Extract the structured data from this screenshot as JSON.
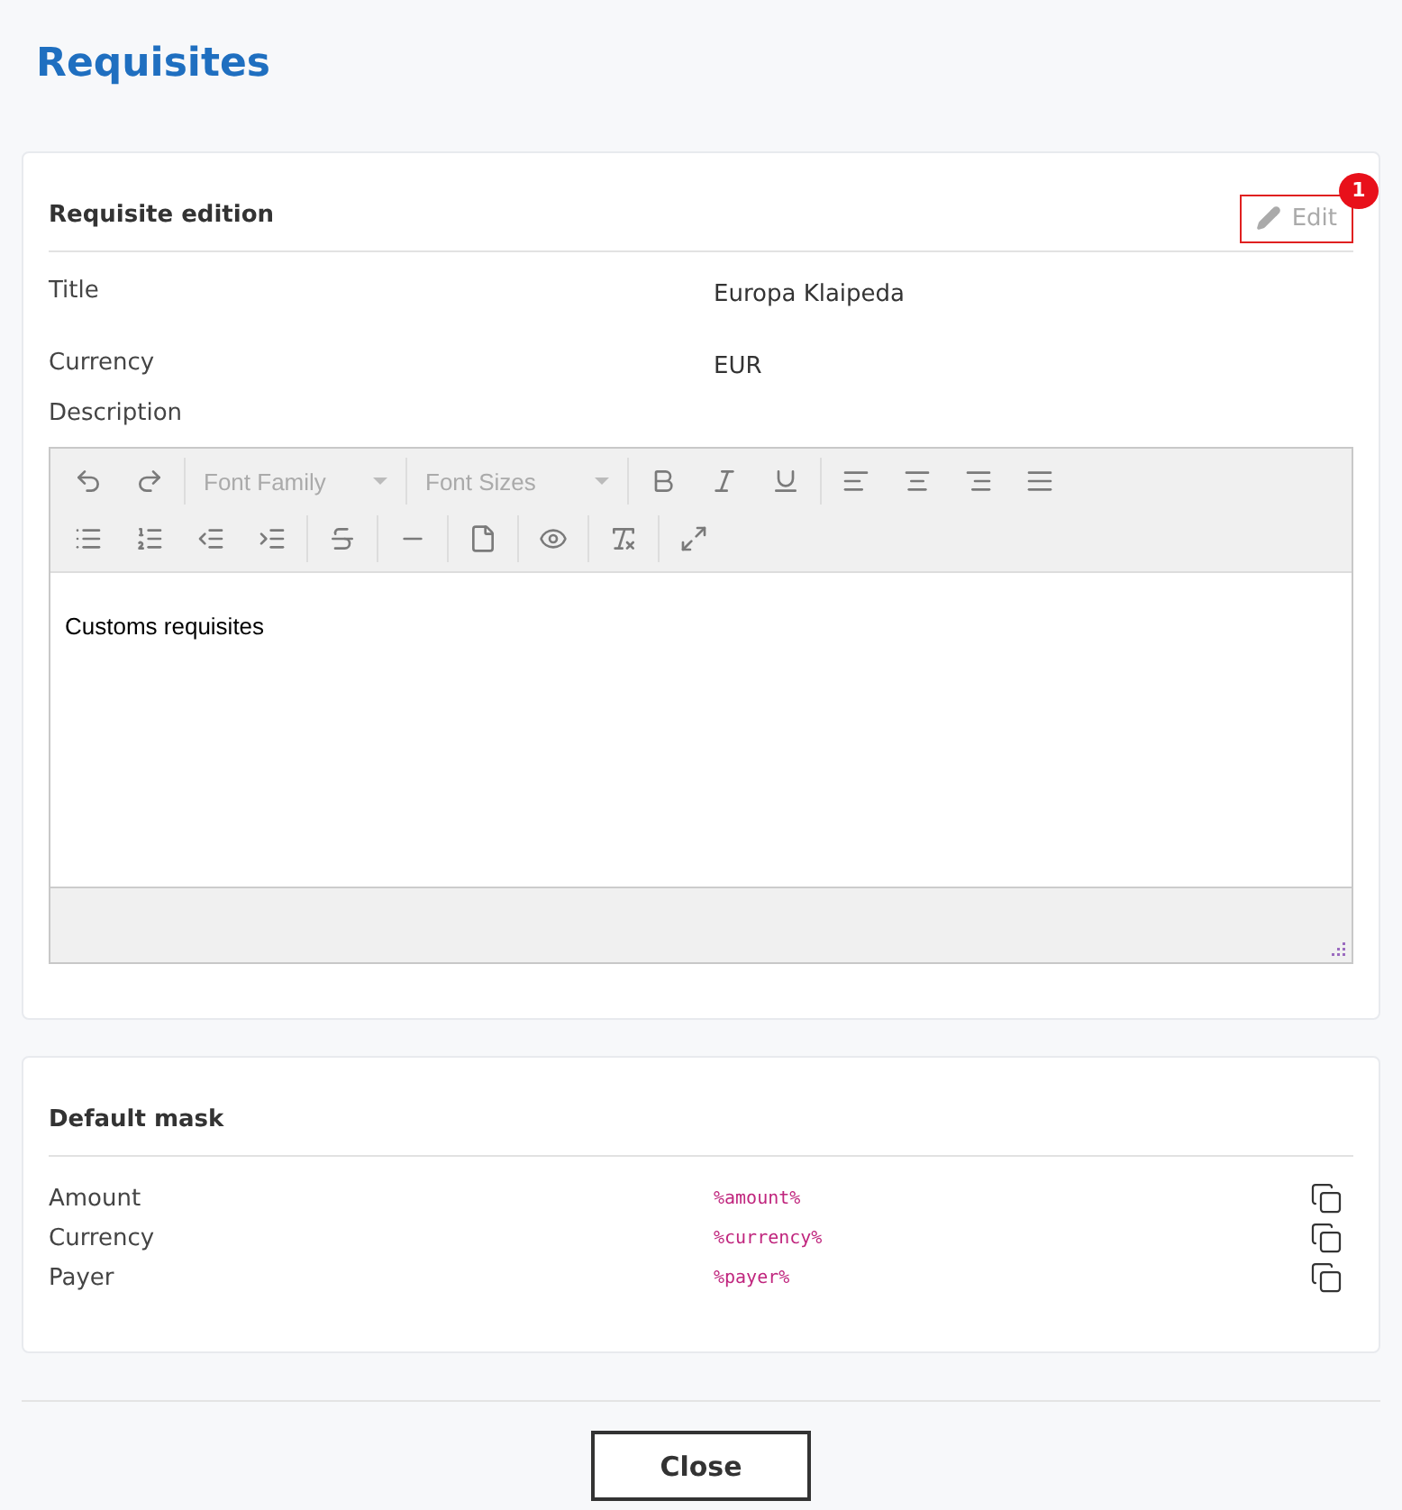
{
  "page_title": "Requisites",
  "requisite_card": {
    "heading": "Requisite edition",
    "edit_button": {
      "label": "Edit",
      "disabled": true,
      "badge": "1"
    },
    "fields": [
      {
        "label": "Title",
        "value": "Europa Klaipeda"
      },
      {
        "label": "Currency",
        "value": "EUR"
      }
    ],
    "description_label": "Description",
    "editor": {
      "font_family": "Font Family",
      "font_sizes": "Font Sizes",
      "content": "Customs requisites"
    }
  },
  "mask_card": {
    "heading": "Default mask",
    "rows": [
      {
        "label": "Amount",
        "code": "%amount%"
      },
      {
        "label": "Currency",
        "code": "%currency%"
      },
      {
        "label": "Payer",
        "code": "%payer%"
      }
    ]
  },
  "close_button": "Close"
}
